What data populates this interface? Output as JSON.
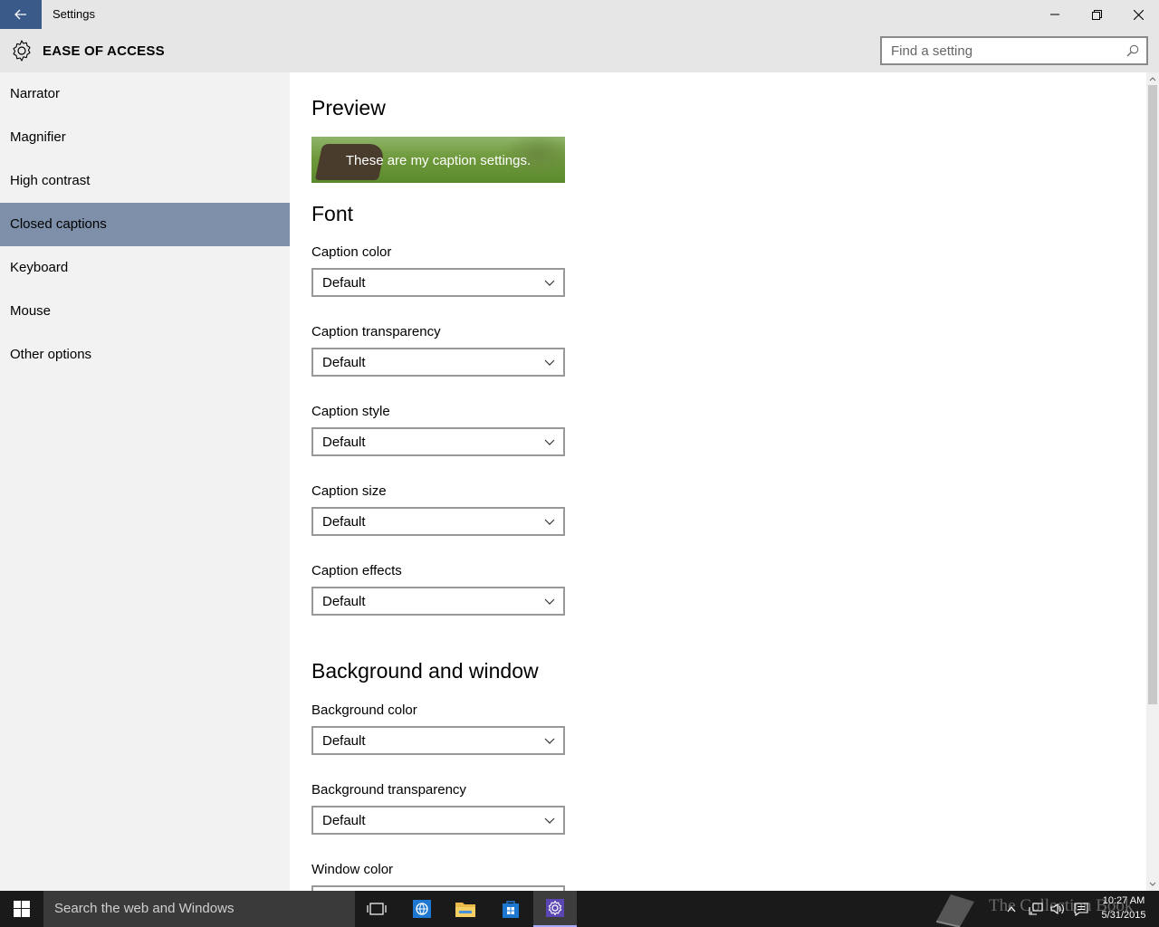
{
  "window": {
    "title": "Settings",
    "back_icon": "back-arrow-icon",
    "minimize_icon": "minimize-icon",
    "restore_icon": "restore-icon",
    "close_icon": "close-icon"
  },
  "header": {
    "icon": "gear-icon",
    "title": "EASE OF ACCESS",
    "search_placeholder": "Find a setting",
    "search_icon": "search-icon"
  },
  "sidebar": {
    "items": [
      {
        "label": "Narrator"
      },
      {
        "label": "Magnifier"
      },
      {
        "label": "High contrast"
      },
      {
        "label": "Closed captions",
        "active": true
      },
      {
        "label": "Keyboard"
      },
      {
        "label": "Mouse"
      },
      {
        "label": "Other options"
      }
    ],
    "active_color": "#7d8fa9"
  },
  "main": {
    "preview": {
      "heading": "Preview",
      "caption_text": "These are my caption settings."
    },
    "font": {
      "heading": "Font",
      "settings": [
        {
          "label": "Caption color",
          "value": "Default"
        },
        {
          "label": "Caption transparency",
          "value": "Default"
        },
        {
          "label": "Caption style",
          "value": "Default"
        },
        {
          "label": "Caption size",
          "value": "Default"
        },
        {
          "label": "Caption effects",
          "value": "Default"
        }
      ]
    },
    "background": {
      "heading": "Background and window",
      "settings": [
        {
          "label": "Background color",
          "value": "Default"
        },
        {
          "label": "Background transparency",
          "value": "Default"
        },
        {
          "label": "Window color",
          "value": ""
        }
      ]
    }
  },
  "taskbar": {
    "start_icon": "windows-start-icon",
    "search_text": "Search the web and Windows",
    "icons": [
      "task-view-icon",
      "internet-explorer-icon",
      "file-explorer-icon",
      "store-icon",
      "settings-icon"
    ],
    "watermark": "The Collection Book",
    "time": "10:27 AM",
    "date": "5/31/2015"
  }
}
